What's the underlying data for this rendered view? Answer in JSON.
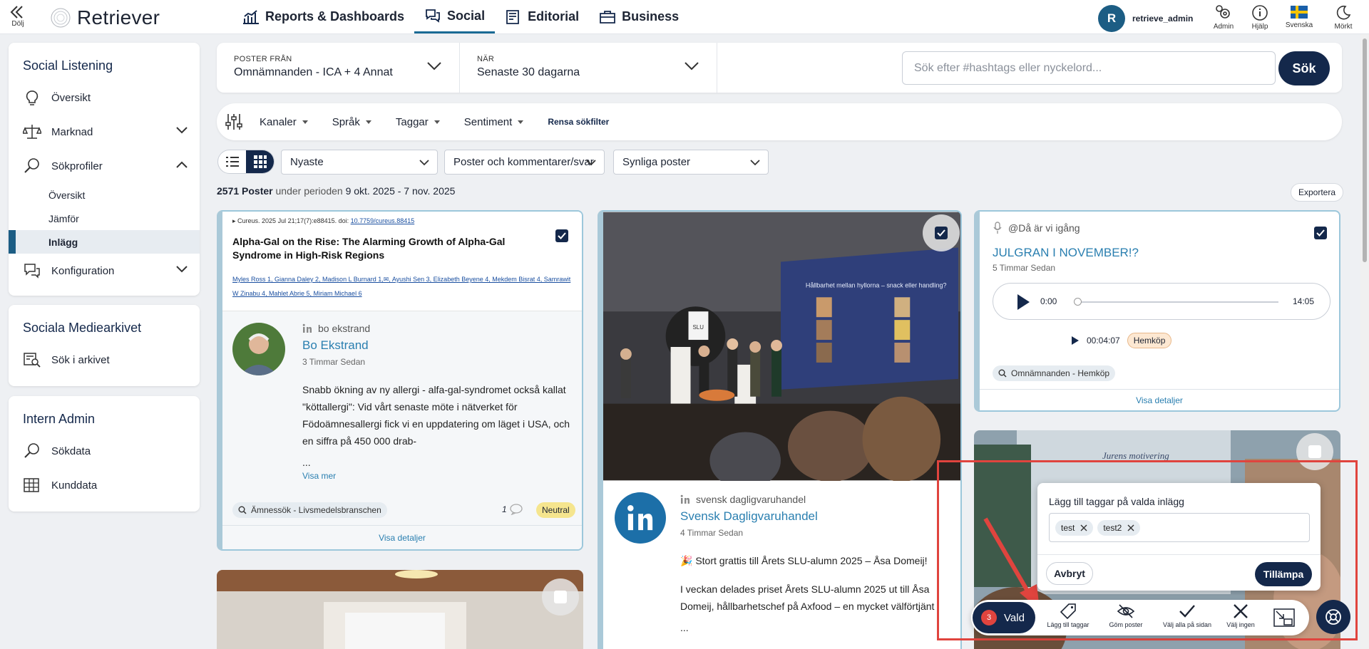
{
  "topbar": {
    "hide_label": "Dölj",
    "logo": "Retriever",
    "nav": [
      {
        "label": "Reports & Dashboards",
        "icon": "bar-chart-icon"
      },
      {
        "label": "Social",
        "icon": "chat-bubbles-icon"
      },
      {
        "label": "Editorial",
        "icon": "newspaper-icon"
      },
      {
        "label": "Business",
        "icon": "briefcase-icon"
      }
    ],
    "user_initial": "R",
    "username": "retrieve_admin",
    "icons": [
      {
        "label": "Admin",
        "icon": "gears-icon"
      },
      {
        "label": "Hjälp",
        "icon": "info-icon"
      },
      {
        "label": "Svenska",
        "icon": "swedish-flag-icon"
      },
      {
        "label": "Mörkt",
        "icon": "moon-icon"
      }
    ]
  },
  "sidebar": {
    "social_listening": {
      "title": "Social Listening",
      "items": [
        {
          "label": "Översikt",
          "icon": "lightbulb-icon"
        },
        {
          "label": "Marknad",
          "icon": "scales-icon"
        },
        {
          "label": "Sökprofiler",
          "icon": "search-chat-icon"
        }
      ],
      "sub_items": [
        "Översikt",
        "Jämför",
        "Inlägg"
      ],
      "config": {
        "label": "Konfiguration",
        "icon": "chat-gear-icon"
      }
    },
    "archive": {
      "title": "Sociala Mediearkivet",
      "items": [
        {
          "label": "Sök i arkivet",
          "icon": "archive-search-icon"
        }
      ]
    },
    "admin": {
      "title": "Intern Admin",
      "items": [
        {
          "label": "Sökdata",
          "icon": "search-chat-icon"
        },
        {
          "label": "Kunddata",
          "icon": "table-icon"
        }
      ]
    }
  },
  "filters": {
    "posts_from_label": "POSTER FRÅN",
    "posts_from_value": "Omnämnanden - ICA + 4 Annat",
    "when_label": "NÄR",
    "when_value": "Senaste 30 dagarna",
    "search_placeholder": "Sök efter #hashtags eller nyckelord...",
    "search_button": "Sök"
  },
  "tagbar": {
    "items": [
      "Kanaler",
      "Språk",
      "Taggar",
      "Sentiment"
    ],
    "clear": "Rensa sökfilter"
  },
  "controls": {
    "sort": "Nyaste",
    "type": "Poster och kommentarer/svar",
    "visibility": "Synliga poster"
  },
  "summary": {
    "count": "2571 Poster",
    "period_text": "under perioden",
    "period": "9 okt. 2025 - 7 nov. 2025",
    "export": "Exportera"
  },
  "cards": {
    "c1": {
      "cite_prefix": "Cureus. 2025 Jul 21;17(7):e88415. doi: ",
      "cite_doi": "10.7759/cureus.88415",
      "paper_title": "Alpha-Gal on the Rise: The Alarming Growth of Alpha-Gal Syndrome in High-Risk Regions",
      "paper_authors": "Myles Ross 1, Gianna Daley 2, Madison L Burnard 1,✉, Ayushi Sen 3, Elizabeth Beyene 4, Mekdem Bisrat 4, Samrawit W Zinabu 4, Mahlet Abrie 5, Miriam Michael 6",
      "source": "bo ekstrand",
      "author": "Bo Ekstrand",
      "time": "3 Timmar Sedan",
      "text": "Snabb ökning av ny allergi - alfa-gal-syndromet också kallat \"köttallergi\": Vid vårt senaste möte i nätverket för Födoämnesallergi fick vi en uppdatering om läget i USA, och en siffra på 450 000 drab-",
      "ellipsis": "...",
      "more": "Visa mer",
      "profile": "Ämnessök - Livsmedelsbranschen",
      "comments": "1",
      "sentiment": "Neutral",
      "details": "Visa detaljer"
    },
    "c2": {
      "slide_title": "Hållbarhet mellan hyllorna – snack eller handling?",
      "slide_brand": "SLU",
      "source": "svensk dagligvaruhandel",
      "author": "Svensk Dagligvaruhandel",
      "time": "4 Timmar Sedan",
      "text1": "🎉 Stort grattis till Årets SLU-alumn 2025 – Åsa Domeij!",
      "text2": "I veckan delades priset Årets SLU-alumn 2025 ut till Åsa Domeij, hållbarhetschef på Axfood – en mycket välförtjänt",
      "ellipsis": "..."
    },
    "c3": {
      "source": "@Då är vi igång",
      "title": "JULGRAN I NOVEMBER!?",
      "time": "5 Timmar Sedan",
      "audio_start": "0:00",
      "audio_end": "14:05",
      "clip_time": "00:04:07",
      "clip_tag": "Hemköp",
      "profile": "Omnämnanden - Hemköp",
      "details": "Visa detaljer"
    },
    "c4": {
      "sign_text": "Jurens motivering"
    }
  },
  "tag_popover": {
    "title": "Lägg till taggar på valda inlägg",
    "tags": [
      "test",
      "test2"
    ],
    "cancel": "Avbryt",
    "apply": "Tillämpa"
  },
  "action_bar": {
    "selected_count": "3",
    "selected_label": "Vald",
    "actions": [
      "Lägg till taggar",
      "Göm poster",
      "Välj alla på sidan",
      "Välj ingen"
    ]
  },
  "colors": {
    "navy": "#14284b",
    "accent_blue": "#1c5d84",
    "link_blue": "#2a7fb0",
    "highlight_red": "#e0443e",
    "card_border": "#9cc7db"
  }
}
